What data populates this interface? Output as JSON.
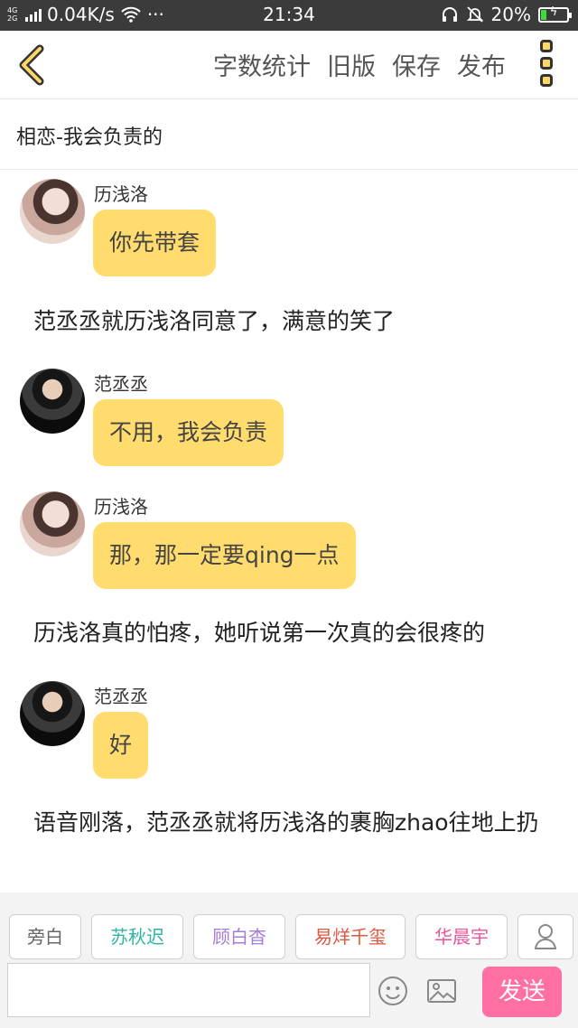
{
  "status_bar": {
    "network": "4G\n2G",
    "speed": "0.04K/s",
    "dots": "···",
    "time": "21:34",
    "battery": "20%",
    "battery_level": 0.2
  },
  "toolbar": {
    "actions": [
      "字数统计",
      "旧版",
      "保存",
      "发布"
    ]
  },
  "document": {
    "title": "相恋-我会负责的"
  },
  "messages": [
    {
      "speaker": "历浅洛",
      "text": "你先带套"
    },
    {
      "narration": "范丞丞就历浅洛同意了，满意的笑了"
    },
    {
      "speaker": "范丞丞",
      "text": "不用，我会负责"
    },
    {
      "speaker": "历浅洛",
      "text": "那，那一定要qing一点"
    },
    {
      "narration": "历浅洛真的怕疼，她听说第一次真的会很疼的"
    },
    {
      "speaker": "范丞丞",
      "text": "好"
    },
    {
      "narration": "语音刚落，范丞丞就将历浅洛的裹胸zhao往地上扔"
    }
  ],
  "characters": [
    {
      "name": "旁白",
      "color": "#666666"
    },
    {
      "name": "苏秋迟",
      "color": "#2fb5a4"
    },
    {
      "name": "顾白杳",
      "color": "#a77bd8"
    },
    {
      "name": "易烊千玺",
      "color": "#e0563f"
    },
    {
      "name": "华晨宇",
      "color": "#e8569a"
    }
  ],
  "composer": {
    "send_label": "发送",
    "input_value": ""
  }
}
